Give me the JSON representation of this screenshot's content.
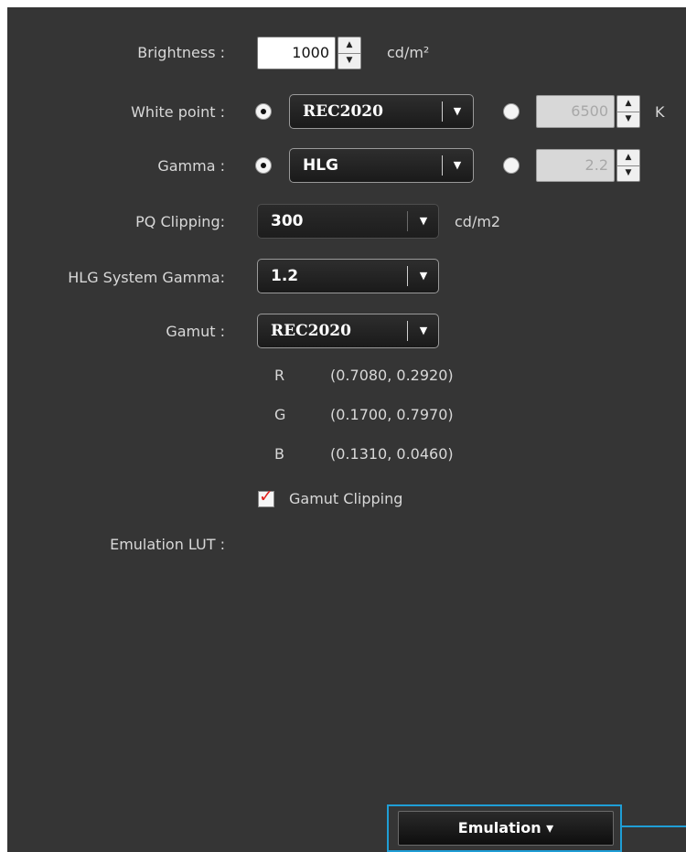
{
  "brightness": {
    "label": "Brightness :",
    "value": "1000",
    "unit": "cd/m²"
  },
  "white_point": {
    "label": "White point :",
    "preset_value": "REC2020",
    "custom_value": "6500",
    "custom_unit": "K",
    "selected": "preset"
  },
  "gamma": {
    "label": "Gamma :",
    "preset_value": "HLG",
    "custom_value": "2.2",
    "selected": "preset"
  },
  "pq_clipping": {
    "label": "PQ Clipping:",
    "value": "300",
    "unit": "cd/m2"
  },
  "hlg_system_gamma": {
    "label": "HLG System Gamma:",
    "value": "1.2"
  },
  "gamut": {
    "label": "Gamut :",
    "value": "REC2020",
    "primaries": [
      {
        "name": "R",
        "coords": "(0.7080, 0.2920)"
      },
      {
        "name": "G",
        "coords": "(0.1700, 0.7970)"
      },
      {
        "name": "B",
        "coords": "(0.1310, 0.0460)"
      }
    ],
    "clipping_label": "Gamut Clipping",
    "clipping_checked": true
  },
  "emulation_lut": {
    "label": "Emulation LUT :"
  },
  "emulation_button": {
    "label": "Emulation ▾"
  },
  "icons": {
    "spin_up": "triangle-up",
    "spin_down": "triangle-down",
    "dropdown": "triangle-down",
    "check": "check-mark"
  },
  "colors": {
    "panel_bg": "#353535",
    "accent": "#1f9ed6",
    "check": "#e0201c"
  }
}
